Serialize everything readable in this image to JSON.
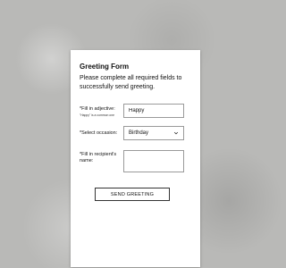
{
  "form": {
    "title": "Greeting Form",
    "intro": "Please complete all required fields to successfully send greeting.",
    "adjective": {
      "label": "*Fill in adjective:",
      "hint": "\"Happy\" is a common one",
      "value": "Happy"
    },
    "occasion": {
      "label": "*Select occasion:",
      "selected": "Birthday"
    },
    "recipient": {
      "label": "*Fill in recipient's name:",
      "value": ""
    },
    "submit_label": "SEND GREETING"
  },
  "icons": {
    "occasion_dropdown": "chevron-down-icon"
  }
}
